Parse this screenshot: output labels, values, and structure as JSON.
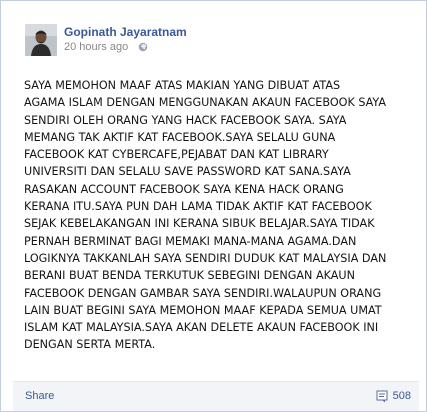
{
  "post": {
    "author": "Gopinath Jayaratnam",
    "timestamp": "20 hours ago",
    "message_lines": [
      "SAYA MEMOHON MAAF ATAS MAKIAN YANG DIBUAT ATAS",
      "AGAMA ISLAM DENGAN MENGGUNAKAN AKAUN FACEBOOK SAYA",
      "SENDIRI OLEH ORANG YANG HACK FACEBOOK SAYA. SAYA",
      "MEMANG TAK AKTIF KAT FACEBOOK.SAYA SELALU GUNA",
      "FACEBOOK KAT CYBERCAFE,PEJABAT DAN KAT LIBRARY",
      "UNIVERSITI DAN SELALU SAVE PASSWORD KAT SANA.SAYA",
      "RASAKAN ACCOUNT FACEBOOK SAYA KENA HACK ORANG",
      "KERANA ITU.SAYA PUN DAH LAMA TIDAK AKTIF KAT FACEBOOK",
      "SEJAK KEBELAKANGAN INI KERANA SIBUK BELAJAR.SAYA TIDAK",
      "PERNAH BERMINAT BAGI MEMAKI MANA-MANA AGAMA.DAN",
      "LOGIKNYA TAKKANLAH SAYA SENDIRI DUDUK KAT MALAYSIA DAN",
      "BERANI BUAT BENDA TERKUTUK SEBEGINI DENGAN AKAUN",
      "FACEBOOK DENGAN GAMBAR SAYA SENDIRI.WALAUPUN ORANG",
      "LAIN BUAT BEGINI SAYA MEMOHON MAAF KEPADA SEMUA UMAT",
      "ISLAM KAT MALAYSIA.SAYA AKAN DELETE AKAUN FACEBOOK INI",
      "DENGAN SERTA MERTA."
    ]
  },
  "footer": {
    "share_label": "Share",
    "comment_count": "508"
  },
  "icons": {
    "globe": "globe-icon",
    "comment": "comment-icon"
  },
  "colors": {
    "link": "#3b5998",
    "footer_bg": "#f2f4f8",
    "border": "#c4cde0",
    "text": "#141414",
    "muted": "#888888"
  }
}
